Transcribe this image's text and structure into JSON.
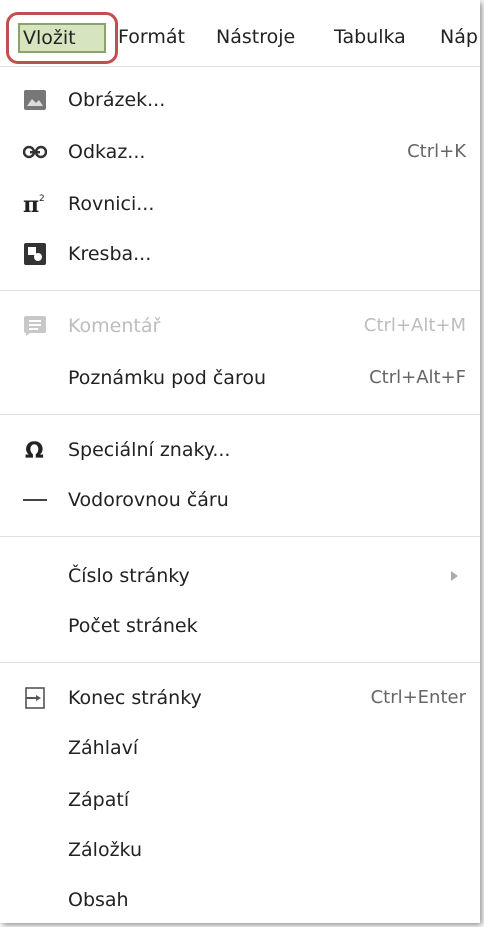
{
  "menubar": {
    "items": [
      "Vložit",
      "Formát",
      "Nástroje",
      "Tabulka",
      "Náp"
    ]
  },
  "menu": {
    "items": [
      {
        "label": "Obrázek...",
        "shortcut": "",
        "icon": "image-icon"
      },
      {
        "label": "Odkaz...",
        "shortcut": "Ctrl+K",
        "icon": "link-icon"
      },
      {
        "label": "Rovnici...",
        "shortcut": "",
        "icon": "equation-icon"
      },
      {
        "label": "Kresba...",
        "shortcut": "",
        "icon": "drawing-icon"
      },
      {
        "label": "Komentář",
        "shortcut": "Ctrl+Alt+M",
        "icon": "comment-icon"
      },
      {
        "label": "Poznámku pod čarou",
        "shortcut": "Ctrl+Alt+F",
        "icon": ""
      },
      {
        "label": "Speciální znaky...",
        "shortcut": "",
        "icon": "omega-icon"
      },
      {
        "label": "Vodorovnou čáru",
        "shortcut": "",
        "icon": "horizontal-line-icon"
      },
      {
        "label": "Číslo stránky",
        "shortcut": "",
        "icon": ""
      },
      {
        "label": "Počet stránek",
        "shortcut": "",
        "icon": ""
      },
      {
        "label": "Konec stránky",
        "shortcut": "Ctrl+Enter",
        "icon": "page-break-icon"
      },
      {
        "label": "Záhlaví",
        "shortcut": "",
        "icon": ""
      },
      {
        "label": "Zápatí",
        "shortcut": "",
        "icon": ""
      },
      {
        "label": "Záložku",
        "shortcut": "",
        "icon": ""
      },
      {
        "label": "Obsah",
        "shortcut": "",
        "icon": ""
      }
    ]
  },
  "colors": {
    "highlight_border": "#c0504d",
    "active_fill": "#d6e5c0",
    "disabled_text": "#bdbdbd"
  }
}
